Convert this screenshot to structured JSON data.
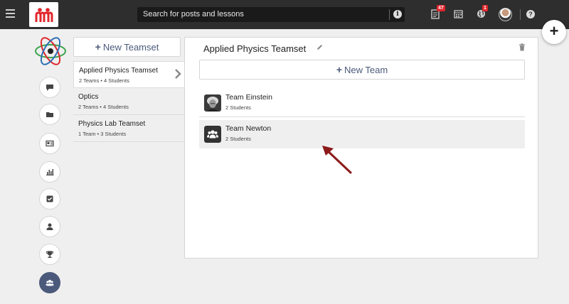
{
  "header": {
    "search_placeholder": "Search for posts and lessons",
    "notifications_count": "47",
    "messages_count": "1"
  },
  "colors": {
    "accent": "#4b5a7b",
    "badge": "#e0262c",
    "topbar": "#2e2e2e"
  },
  "teamsets": {
    "new_label": "New Teamset",
    "items": [
      {
        "name": "Applied Physics Teamset",
        "meta": "2 Teams • 4 Students"
      },
      {
        "name": "Optics",
        "meta": "2 Teams • 4 Students"
      },
      {
        "name": "Physics Lab Teamset",
        "meta": "1 Team • 3 Students"
      }
    ]
  },
  "panel": {
    "title": "Applied Physics Teamset",
    "new_team_label": "New Team",
    "teams": [
      {
        "name": "Team Einstein",
        "meta": "2 Students"
      },
      {
        "name": "Team Newton",
        "meta": "2 Students"
      }
    ]
  },
  "rail": {
    "icons": [
      "comment-icon",
      "folder-icon",
      "id-card-icon",
      "bar-chart-icon",
      "checkbox-icon",
      "user-icon",
      "trophy-icon",
      "users-icon"
    ]
  }
}
